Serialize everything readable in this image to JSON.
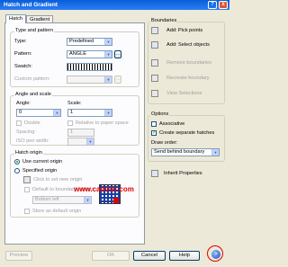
{
  "window": {
    "title": "Hatch and Gradient",
    "help_btn": "?",
    "close_btn": "x"
  },
  "tabs": [
    {
      "label": "Hatch"
    },
    {
      "label": "Gradient"
    }
  ],
  "type_pattern": {
    "title": "Type and pattern",
    "type_label": "Type:",
    "type_value": "Predefined",
    "pattern_label": "Pattern:",
    "pattern_value": "ANGLE",
    "swatch_label": "Swatch:",
    "custom_label": "Custom pattern:"
  },
  "angle_scale": {
    "title": "Angle and scale",
    "angle_label": "Angle:",
    "angle_value": "0",
    "scale_label": "Scale:",
    "scale_value": "1",
    "double_label": "Double",
    "relative_label": "Relative to paper space",
    "spacing_label": "Spacing:",
    "spacing_value": "1",
    "iso_label": "ISO pen width:"
  },
  "hatch_origin": {
    "title": "Hatch origin",
    "use_current": "Use current origin",
    "specified": "Specified origin",
    "click_new": "Click to set new origin",
    "default_boundary": "Default to boundary extents",
    "position_value": "Bottom left",
    "store_default": "Store as default origin"
  },
  "watermark": "www.cadviet.com",
  "boundaries": {
    "title": "Boundaries",
    "add_pick": "Add: Pick points",
    "add_select": "Add: Select objects",
    "remove_boundaries": "Remove boundaries",
    "recreate_boundary": "Recreate boundary",
    "view_selections": "View Selections"
  },
  "options": {
    "title": "Options",
    "associative": "Associative",
    "create_separate": "Create separate hatches",
    "draw_order_label": "Draw order:",
    "draw_order_value": "Send behind boundary"
  },
  "inherit": "Inherit Properties",
  "footer": {
    "preview": "Preview",
    "ok": "OK",
    "cancel": "Cancel",
    "help": "Help",
    "more": ">"
  }
}
